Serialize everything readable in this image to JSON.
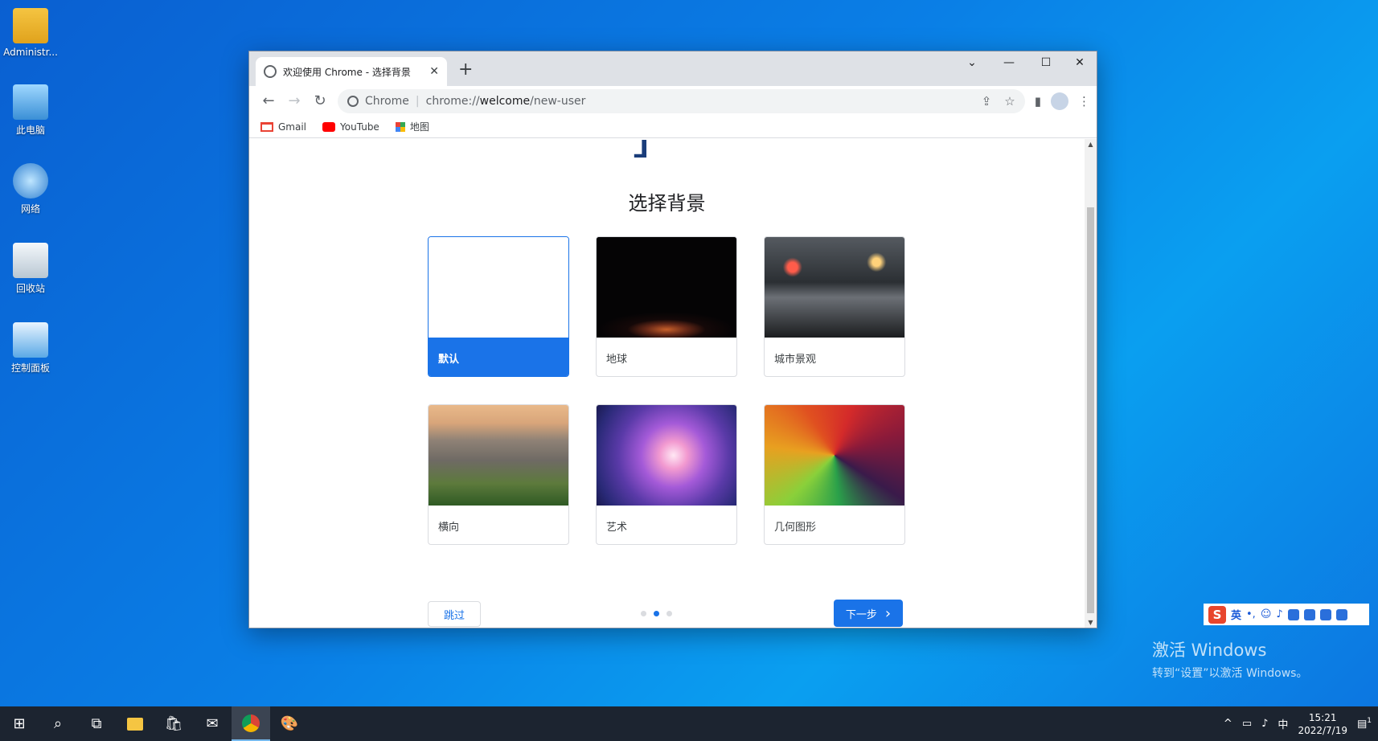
{
  "desktop": {
    "icons": [
      {
        "label": "Administr..."
      },
      {
        "label": "此电脑"
      },
      {
        "label": "网络"
      },
      {
        "label": "回收站"
      },
      {
        "label": "控制面板"
      }
    ]
  },
  "browser": {
    "tab_title": "欢迎使用 Chrome - 选择背景",
    "tab_close": "✕",
    "new_tab": "+",
    "window_controls": {
      "tabsearch": "⌄",
      "minimize": "—",
      "maximize": "☐",
      "close": "✕"
    },
    "nav": {
      "back": "←",
      "forward": "→",
      "reload": "↻"
    },
    "omnibox": {
      "site_label": "Chrome",
      "url_scheme": "chrome://",
      "url_host": "welcome",
      "url_path": "/new-user"
    },
    "bookmarks": [
      {
        "label": "Gmail"
      },
      {
        "label": "YouTube"
      },
      {
        "label": "地图"
      }
    ]
  },
  "page": {
    "title": "选择背景",
    "backgrounds": [
      {
        "label": "默认"
      },
      {
        "label": "地球"
      },
      {
        "label": "城市景观"
      },
      {
        "label": "横向"
      },
      {
        "label": "艺术"
      },
      {
        "label": "几何图形"
      }
    ],
    "skip_label": "跳过",
    "next_label": "下一步",
    "next_chevron": "›",
    "step_current": 2,
    "step_total": 3
  },
  "activation": {
    "line1": "激活 Windows",
    "line2": "转到“设置”以激活 Windows。"
  },
  "ime": {
    "logo": "S",
    "mode": "英"
  },
  "taskbar": {
    "tray_lang": "中",
    "time": "15:21",
    "date": "2022/7/19",
    "notification_count": "1"
  }
}
